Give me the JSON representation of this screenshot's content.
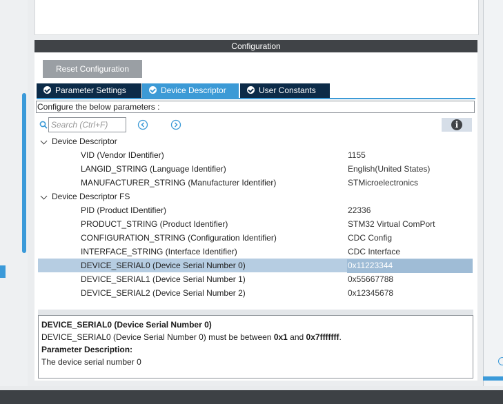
{
  "config_header": "Configuration",
  "reset_button": "Reset Configuration",
  "tabs": [
    {
      "label": "Parameter Settings",
      "active": false
    },
    {
      "label": "Device Descriptor",
      "active": true
    },
    {
      "label": "User Constants",
      "active": false
    }
  ],
  "configure_text": "Configure the below parameters :",
  "search": {
    "placeholder": "Search (Ctrl+F)"
  },
  "info_icon": "i",
  "tree": [
    {
      "type": "group",
      "name": "Device Descriptor"
    },
    {
      "type": "param",
      "name": "VID (Vendor IDentifier)",
      "value": "1155"
    },
    {
      "type": "param",
      "name": "LANGID_STRING (Language Identifier)",
      "value": "English(United States)"
    },
    {
      "type": "param",
      "name": "MANUFACTURER_STRING (Manufacturer Identifier)",
      "value": "STMicroelectronics"
    },
    {
      "type": "group",
      "name": "Device Descriptor FS"
    },
    {
      "type": "param",
      "name": "PID (Product IDentifier)",
      "value": "22336"
    },
    {
      "type": "param",
      "name": "PRODUCT_STRING (Product Identifier)",
      "value": "STM32 Virtual ComPort"
    },
    {
      "type": "param",
      "name": "CONFIGURATION_STRING (Configuration Identifier)",
      "value": "CDC Config"
    },
    {
      "type": "param",
      "name": "INTERFACE_STRING (Interface Identifier)",
      "value": "CDC Interface"
    },
    {
      "type": "param",
      "name": "DEVICE_SERIAL0 (Device Serial Number 0)",
      "value": "0x11223344",
      "selected": true
    },
    {
      "type": "param",
      "name": "DEVICE_SERIAL1 (Device Serial Number 1)",
      "value": "0x55667788"
    },
    {
      "type": "param",
      "name": "DEVICE_SERIAL2 (Device Serial Number 2)",
      "value": "0x12345678"
    }
  ],
  "description": {
    "title": "DEVICE_SERIAL0 (Device Serial Number 0)",
    "line_prefix": "DEVICE_SERIAL0 (Device Serial Number 0) must be between ",
    "min": "0x1",
    "and": " and ",
    "max": "0x7fffffff",
    "period": ".",
    "param_heading": "Parameter Description:",
    "param_text": "The device serial number 0"
  },
  "colors": {
    "tab_active": "#3c9ad6",
    "tab_inactive": "#0c2b48",
    "header_bar": "#404347",
    "selection": "#b6cde2"
  }
}
